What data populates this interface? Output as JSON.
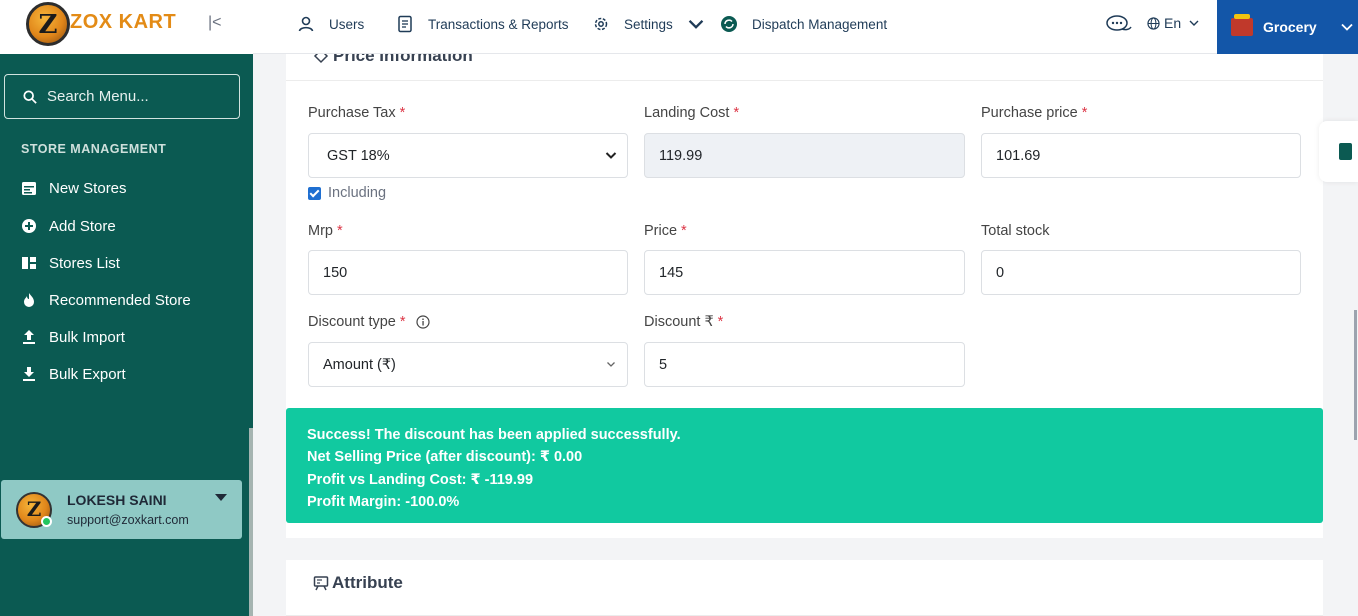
{
  "brand": {
    "logo_letter": "Z",
    "name": "ZOX KART"
  },
  "sidebar": {
    "search_placeholder": "Search Menu...",
    "section_title": "STORE MANAGEMENT",
    "items": [
      {
        "label": "New Stores",
        "icon": "calendar-icon"
      },
      {
        "label": "Add Store",
        "icon": "plus-circle-icon"
      },
      {
        "label": "Stores List",
        "icon": "grid-icon"
      },
      {
        "label": "Recommended Store",
        "icon": "flame-icon"
      },
      {
        "label": "Bulk Import",
        "icon": "upload-icon"
      },
      {
        "label": "Bulk Export",
        "icon": "download-icon"
      }
    ],
    "user": {
      "name": "LOKESH SAINI",
      "email": "support@zoxkart.com"
    }
  },
  "topnav": {
    "users": "Users",
    "transactions": "Transactions & Reports",
    "settings": "Settings",
    "dispatch": "Dispatch Management",
    "language": "En",
    "store_switch": "Grocery"
  },
  "price_section": {
    "title": "Price Information",
    "purchase_tax": {
      "label": "Purchase Tax",
      "value": "GST 18%"
    },
    "including_label": "Including",
    "landing_cost": {
      "label": "Landing Cost",
      "value": "119.99"
    },
    "purchase_price": {
      "label": "Purchase price",
      "value": "101.69"
    },
    "mrp": {
      "label": "Mrp",
      "value": "150"
    },
    "price": {
      "label": "Price",
      "value": "145"
    },
    "total_stock": {
      "label": "Total stock",
      "value": "0"
    },
    "discount_type": {
      "label": "Discount type",
      "value": "Amount (₹)"
    },
    "discount": {
      "label": "Discount ₹",
      "value": "5"
    },
    "required_mark": "*"
  },
  "alert": {
    "line1": "Success! The discount has been applied successfully.",
    "line2": "Net Selling Price (after discount): ₹ 0.00",
    "line3": "Profit vs Landing Cost: ₹ -119.99",
    "line4": "Profit Margin: -100.0%"
  },
  "attribute_section": {
    "title": "Attribute"
  },
  "colors": {
    "sidebar_bg": "#0b5a52",
    "accent_blue": "#1356a8",
    "success": "#11c9a0",
    "brand_orange": "#e38b16"
  }
}
